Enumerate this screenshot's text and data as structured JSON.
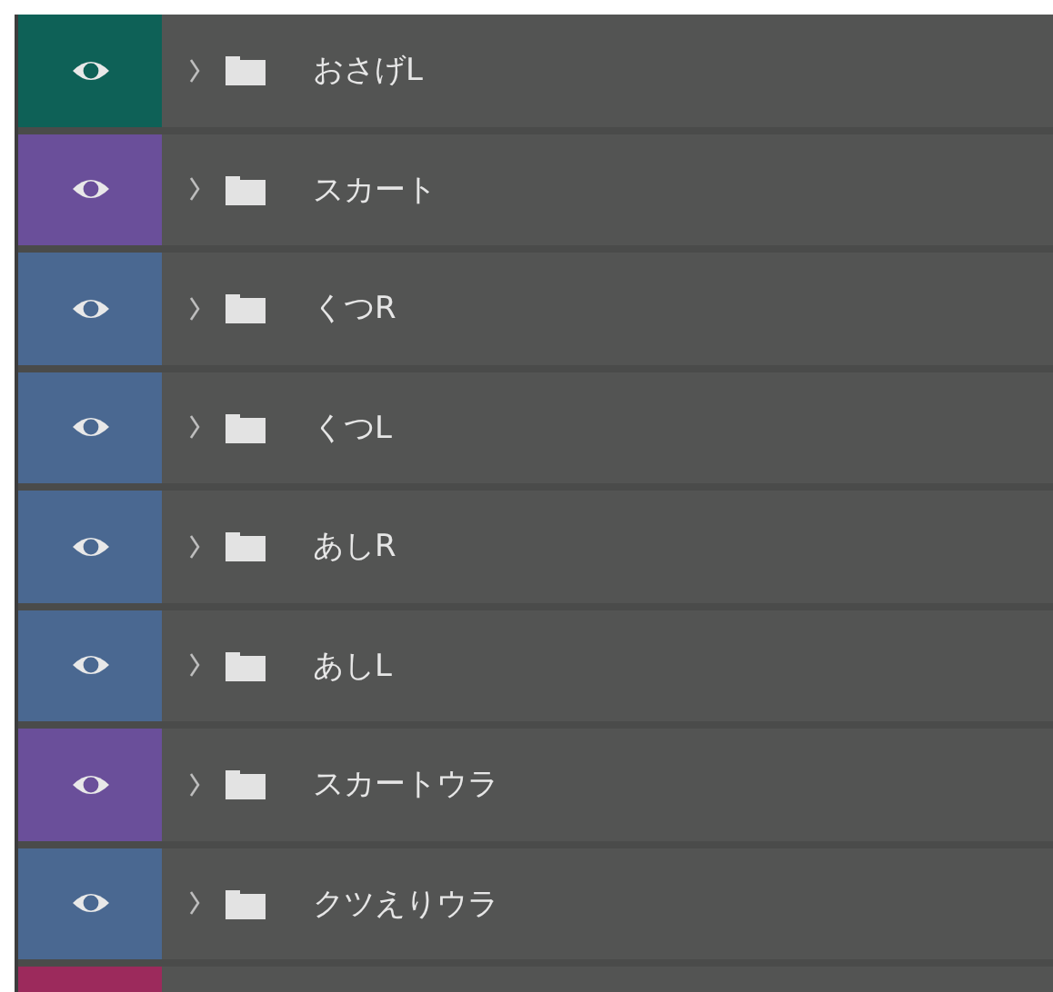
{
  "layers": [
    {
      "name": "おさげL",
      "color": "#0e6157",
      "visible": true
    },
    {
      "name": "スカート",
      "color": "#6a4f9a",
      "visible": true
    },
    {
      "name": "くつR",
      "color": "#4a6891",
      "visible": true
    },
    {
      "name": "くつL",
      "color": "#4a6891",
      "visible": true
    },
    {
      "name": "あしR",
      "color": "#4a6891",
      "visible": true
    },
    {
      "name": "あしL",
      "color": "#4a6891",
      "visible": true
    },
    {
      "name": "スカートウラ",
      "color": "#6a4f9a",
      "visible": true
    },
    {
      "name": "クツえりウラ",
      "color": "#4a6891",
      "visible": true
    },
    {
      "color": "#9c2a5c"
    }
  ]
}
